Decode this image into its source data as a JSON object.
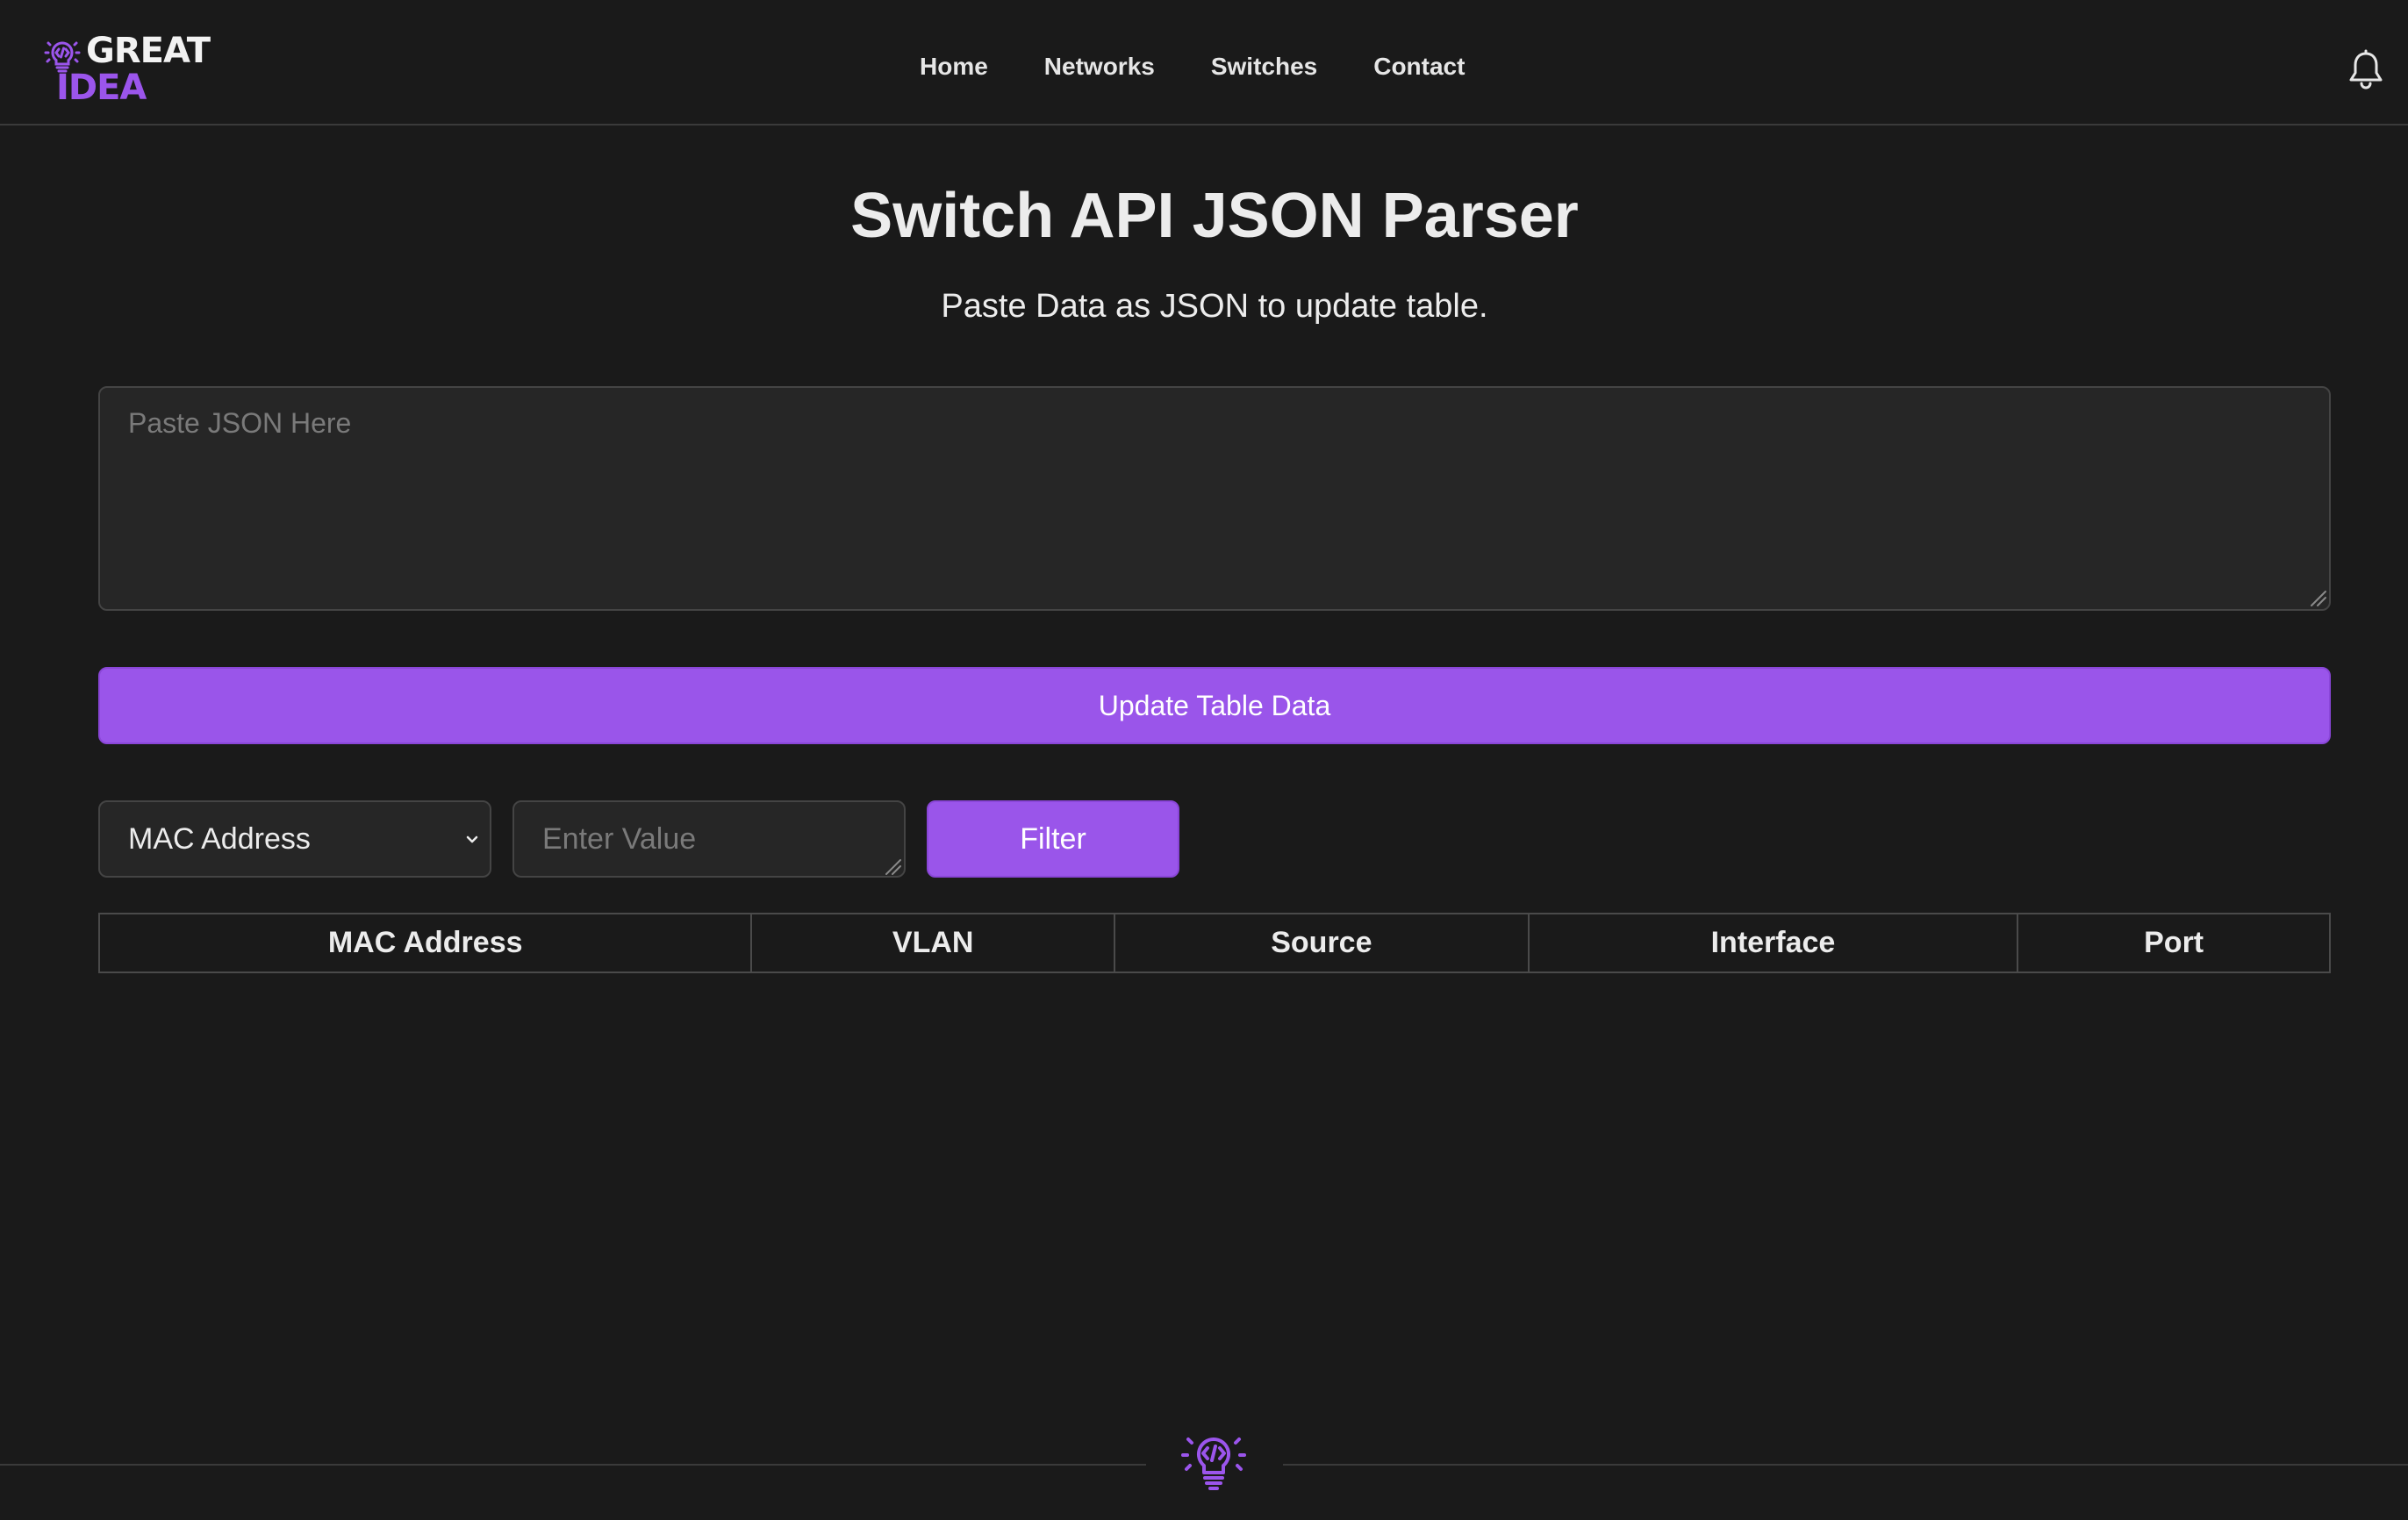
{
  "brand": {
    "line1": "GREAT",
    "line2": "IDEA",
    "accent_color": "#9b55ec"
  },
  "nav": {
    "items": [
      {
        "label": "Home"
      },
      {
        "label": "Networks"
      },
      {
        "label": "Switches"
      },
      {
        "label": "Contact"
      }
    ],
    "notification_icon": "bell-icon"
  },
  "main": {
    "title": "Switch API JSON Parser",
    "subtitle": "Paste Data as JSON to update table.",
    "json_input": {
      "placeholder": "Paste JSON Here",
      "value": ""
    },
    "update_button": "Update Table Data"
  },
  "filter": {
    "field_selected": "MAC Address",
    "value_input": {
      "placeholder": "Enter Value",
      "value": ""
    },
    "button": "Filter"
  },
  "table": {
    "columns": [
      "MAC Address",
      "VLAN",
      "Source",
      "Interface",
      "Port"
    ],
    "rows": []
  },
  "footer": {
    "icon": "lightbulb-code-icon"
  },
  "colors": {
    "background": "#1a1a1a",
    "accent": "#9a55ea",
    "surface": "#262626",
    "border": "#444444"
  }
}
